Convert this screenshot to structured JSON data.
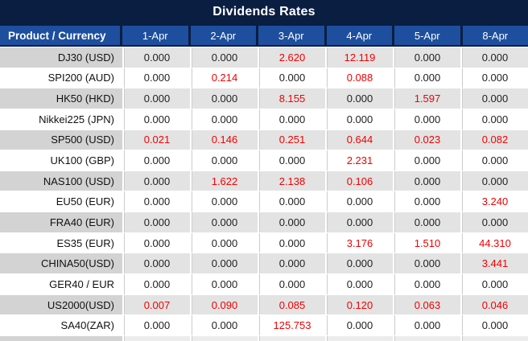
{
  "title": "Dividends Rates",
  "colors": {
    "title_bar_navy": "#0a1e42",
    "header_blue": "#1d4f9e",
    "alt_row_product_gray": "#d3d3d3",
    "alt_row_value_gray": "#e3e3e3",
    "value_red": "#f20000",
    "value_black": "#1f1f1f"
  },
  "columns": {
    "product_label": "Product / Currency",
    "dates": [
      "1-Apr",
      "2-Apr",
      "3-Apr",
      "4-Apr",
      "5-Apr",
      "8-Apr"
    ]
  },
  "rows": [
    {
      "product": "DJ30 (USD)",
      "values": [
        "0.000",
        "0.000",
        "2.620",
        "12.119",
        "0.000",
        "0.000"
      ],
      "red": [
        0,
        0,
        1,
        1,
        0,
        0
      ]
    },
    {
      "product": "SPI200 (AUD)",
      "values": [
        "0.000",
        "0.214",
        "0.000",
        "0.088",
        "0.000",
        "0.000"
      ],
      "red": [
        0,
        1,
        0,
        1,
        0,
        0
      ]
    },
    {
      "product": "HK50 (HKD)",
      "values": [
        "0.000",
        "0.000",
        "8.155",
        "0.000",
        "1.597",
        "0.000"
      ],
      "red": [
        0,
        0,
        1,
        0,
        1,
        0
      ]
    },
    {
      "product": "Nikkei225 (JPN)",
      "values": [
        "0.000",
        "0.000",
        "0.000",
        "0.000",
        "0.000",
        "0.000"
      ],
      "red": [
        0,
        0,
        0,
        0,
        0,
        0
      ]
    },
    {
      "product": "SP500 (USD)",
      "values": [
        "0.021",
        "0.146",
        "0.251",
        "0.644",
        "0.023",
        "0.082"
      ],
      "red": [
        1,
        1,
        1,
        1,
        1,
        1
      ]
    },
    {
      "product": "UK100 (GBP)",
      "values": [
        "0.000",
        "0.000",
        "0.000",
        "2.231",
        "0.000",
        "0.000"
      ],
      "red": [
        0,
        0,
        0,
        1,
        0,
        0
      ]
    },
    {
      "product": "NAS100 (USD)",
      "values": [
        "0.000",
        "1.622",
        "2.138",
        "0.106",
        "0.000",
        "0.000"
      ],
      "red": [
        0,
        1,
        1,
        1,
        0,
        0
      ]
    },
    {
      "product": "EU50 (EUR)",
      "values": [
        "0.000",
        "0.000",
        "0.000",
        "0.000",
        "0.000",
        "3.240"
      ],
      "red": [
        0,
        0,
        0,
        0,
        0,
        1
      ]
    },
    {
      "product": "FRA40 (EUR)",
      "values": [
        "0.000",
        "0.000",
        "0.000",
        "0.000",
        "0.000",
        "0.000"
      ],
      "red": [
        0,
        0,
        0,
        0,
        0,
        0
      ]
    },
    {
      "product": "ES35 (EUR)",
      "values": [
        "0.000",
        "0.000",
        "0.000",
        "3.176",
        "1.510",
        "44.310"
      ],
      "red": [
        0,
        0,
        0,
        1,
        1,
        1
      ]
    },
    {
      "product": "CHINA50(USD)",
      "values": [
        "0.000",
        "0.000",
        "0.000",
        "0.000",
        "0.000",
        "3.441"
      ],
      "red": [
        0,
        0,
        0,
        0,
        0,
        1
      ]
    },
    {
      "product": "GER40 / EUR",
      "values": [
        "0.000",
        "0.000",
        "0.000",
        "0.000",
        "0.000",
        "0.000"
      ],
      "red": [
        0,
        0,
        0,
        0,
        0,
        0
      ]
    },
    {
      "product": "US2000(USD)",
      "values": [
        "0.007",
        "0.090",
        "0.085",
        "0.120",
        "0.063",
        "0.046"
      ],
      "red": [
        1,
        1,
        1,
        1,
        1,
        1
      ]
    },
    {
      "product": "SA40(ZAR)",
      "values": [
        "0.000",
        "0.000",
        "125.753",
        "0.000",
        "0.000",
        "0.000"
      ],
      "red": [
        0,
        0,
        1,
        0,
        0,
        0
      ]
    }
  ]
}
